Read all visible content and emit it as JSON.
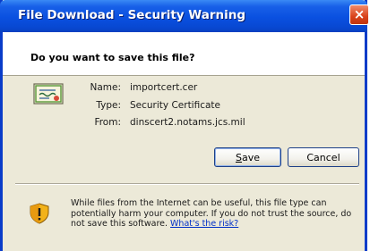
{
  "window": {
    "title": "File Download - Security Warning",
    "close_glyph": "×"
  },
  "prompt": {
    "question": "Do you want to save this file?"
  },
  "file": {
    "icon": "certificate-icon",
    "name_label": "Name:",
    "name_value": "importcert.cer",
    "type_label": "Type:",
    "type_value": "Security Certificate",
    "from_label": "From:",
    "from_value": "dinscert2.notams.jcs.mil"
  },
  "buttons": {
    "save_label_mnemonic": "S",
    "save_label_rest": "ave",
    "cancel_label": "Cancel"
  },
  "warning": {
    "icon": "security-shield-icon",
    "text": "While files from the Internet can be useful, this file type can potentially harm your computer. If you do not trust the source, do not save this software. ",
    "link": "What's the risk?"
  },
  "colors": {
    "titlebar": "#0a50e0",
    "dialog_bg": "#ece9d8",
    "link": "#0030c8",
    "close_button": "#d9421b"
  }
}
